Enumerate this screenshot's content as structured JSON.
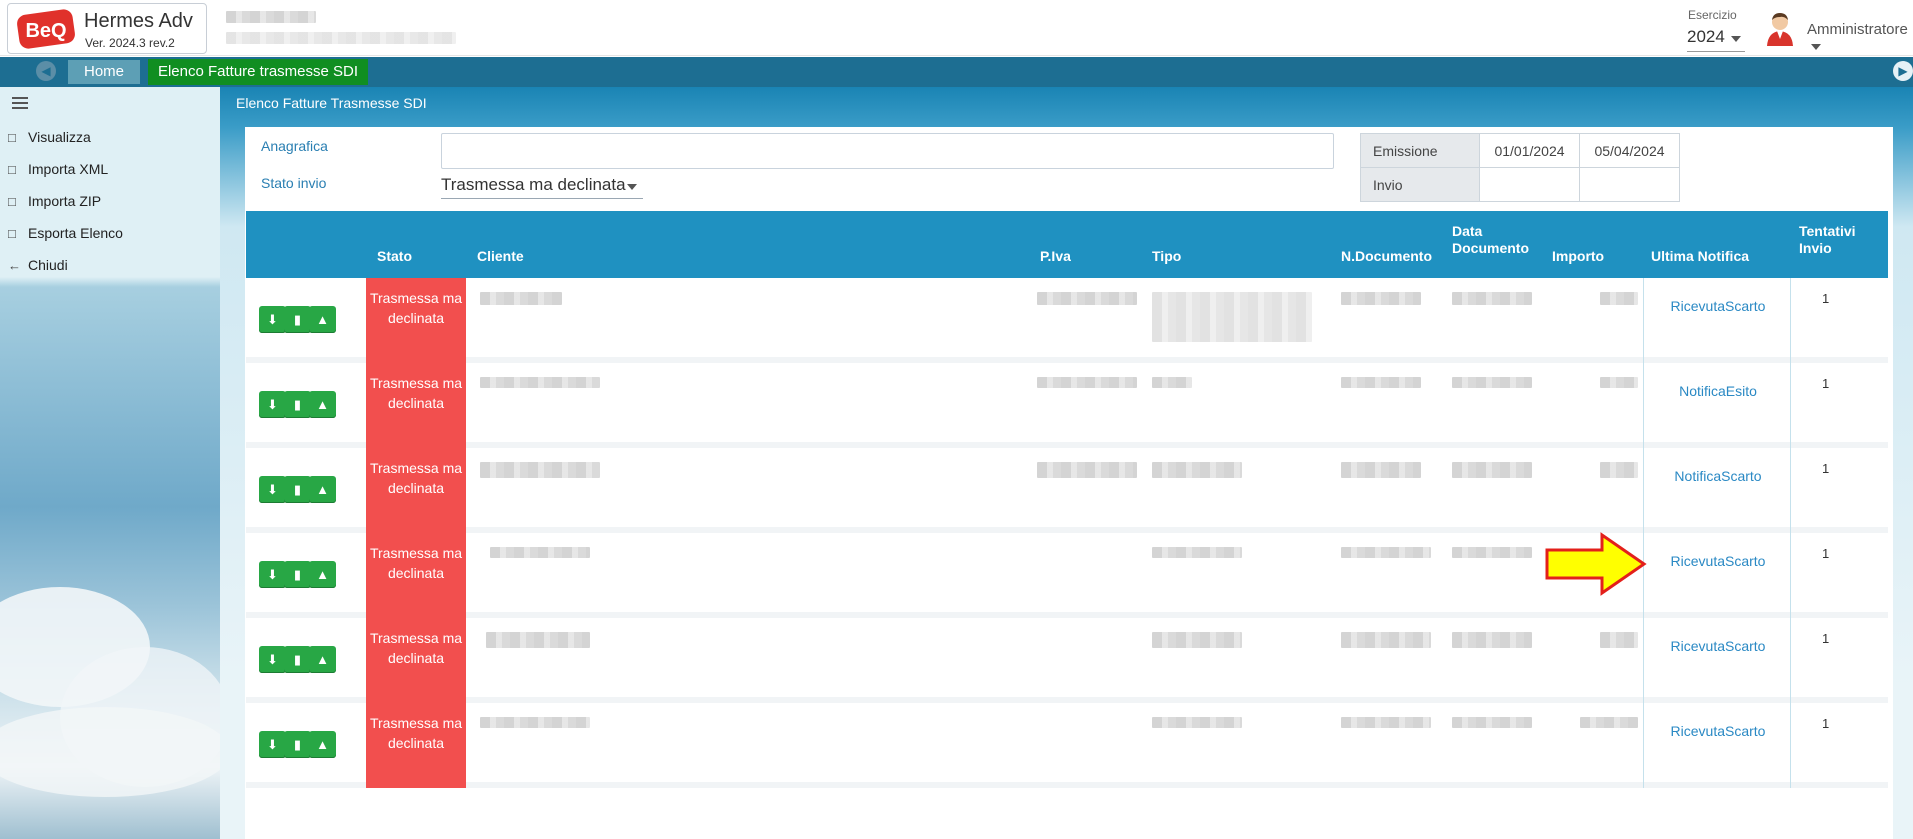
{
  "app": {
    "name": "Hermes Adv",
    "version": "Ver. 2024.3 rev.2",
    "logo_text": "BeQ"
  },
  "header": {
    "esercizio_label": "Esercizio",
    "esercizio_value": "2024",
    "user_name": "Amministratore"
  },
  "navbar": {
    "home_tab": "Home",
    "current_tab": "Elenco Fatture trasmesse SDI"
  },
  "sidebar": {
    "items": [
      {
        "label": "Visualizza",
        "icon": "file-icon"
      },
      {
        "label": "Importa XML",
        "icon": "file-code-icon"
      },
      {
        "label": "Importa ZIP",
        "icon": "file-archive-icon"
      },
      {
        "label": "Esporta Elenco",
        "icon": "file-export-icon"
      },
      {
        "label": "Chiudi",
        "icon": "arrow-left-icon"
      }
    ]
  },
  "panel": {
    "title": "Elenco Fatture Trasmesse SDI"
  },
  "filters": {
    "anagrafica_label": "Anagrafica",
    "anagrafica_value": "",
    "stato_invio_label": "Stato invio",
    "stato_invio_value": "Trasmessa ma declinata",
    "emissione_label": "Emissione",
    "emissione_from": "01/01/2024",
    "emissione_to": "05/04/2024",
    "invio_label": "Invio",
    "invio_from": "",
    "invio_to": ""
  },
  "table": {
    "columns": {
      "stato": "Stato",
      "cliente": "Cliente",
      "piva": "P.Iva",
      "tipo": "Tipo",
      "ndocumento": "N.Documento",
      "data_documento": "Data Documento",
      "importo": "Importo",
      "ultima_notifica": "Ultima Notifica",
      "tentativi": "Tentativi Invio"
    },
    "rows": [
      {
        "stato": "Trasmessa ma declinata",
        "notifica": "RicevutaScarto",
        "tentativi": "1"
      },
      {
        "stato": "Trasmessa ma declinata",
        "notifica": "NotificaEsito",
        "tentativi": "1"
      },
      {
        "stato": "Trasmessa ma declinata",
        "notifica": "NotificaScarto",
        "tentativi": "1"
      },
      {
        "stato": "Trasmessa ma declinata",
        "notifica": "RicevutaScarto",
        "tentativi": "1"
      },
      {
        "stato": "Trasmessa ma declinata",
        "notifica": "RicevutaScarto",
        "tentativi": "1"
      },
      {
        "stato": "Trasmessa ma declinata",
        "notifica": "RicevutaScarto",
        "tentativi": "1"
      }
    ]
  },
  "colors": {
    "navbar": "#1d6e92",
    "current_tab": "#108e21",
    "table_header": "#1f91c1",
    "stato_declinata": "#f24f4e",
    "action_button": "#28a745",
    "link": "#2a89c4",
    "annotation_arrow": "#ffff00"
  }
}
